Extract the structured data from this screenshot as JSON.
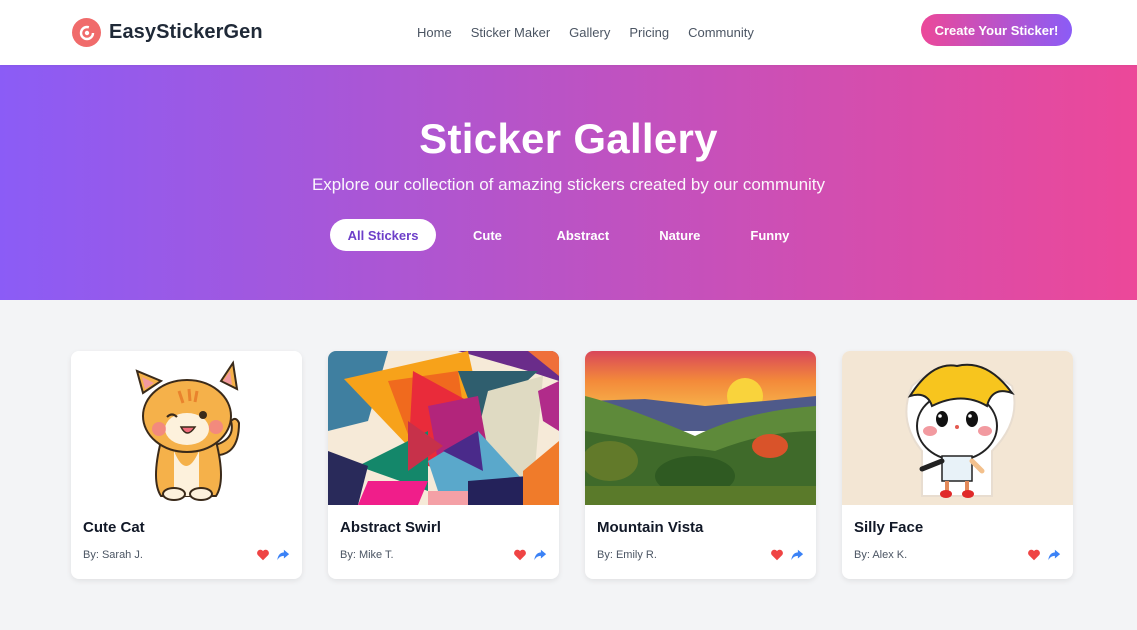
{
  "header": {
    "brand_name": "EasyStickerGen",
    "logo_icon": "sticker-logo-icon",
    "nav": [
      {
        "label": "Home"
      },
      {
        "label": "Sticker Maker"
      },
      {
        "label": "Gallery"
      },
      {
        "label": "Pricing"
      },
      {
        "label": "Community"
      }
    ],
    "cta_label": "Create Your Sticker!"
  },
  "hero": {
    "title": "Sticker Gallery",
    "subtitle": "Explore our collection of amazing stickers created by our community",
    "filters": [
      {
        "label": "All Stickers",
        "active": true
      },
      {
        "label": "Cute",
        "active": false
      },
      {
        "label": "Abstract",
        "active": false
      },
      {
        "label": "Nature",
        "active": false
      },
      {
        "label": "Funny",
        "active": false
      }
    ]
  },
  "gallery": {
    "cards": [
      {
        "title": "Cute Cat",
        "author": "By: Sarah J.",
        "image": "cute-cat-sticker"
      },
      {
        "title": "Abstract Swirl",
        "author": "By: Mike T.",
        "image": "abstract-geometric-art"
      },
      {
        "title": "Mountain Vista",
        "author": "By: Emily R.",
        "image": "mountain-sunset-landscape"
      },
      {
        "title": "Silly Face",
        "author": "By: Alex K.",
        "image": "silly-face-character-sticker"
      }
    ],
    "actions": {
      "like_icon": "heart-icon",
      "share_icon": "share-icon"
    }
  },
  "colors": {
    "brand_gradient_start": "#8b5cf6",
    "brand_gradient_end": "#ec4899",
    "logo": "#f06b6b",
    "like": "#ef4444",
    "share": "#3b82f6"
  }
}
